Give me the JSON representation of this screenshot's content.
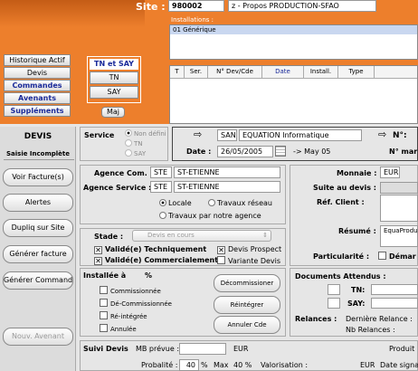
{
  "header": {
    "site_label": "Site :",
    "site_code": "980002",
    "site_name": "z - Propos PRODUCTION-SFAO",
    "installations_label": "Installations :",
    "installations": [
      "01 Générique"
    ],
    "left_links": [
      "Historique Actif",
      "Devis",
      "Commandes",
      "Avenants",
      "Suppléments"
    ],
    "tn_say_title": "TN et SAY",
    "tn_button": "TN",
    "say_button": "SAY",
    "maj_button": "Maj",
    "grid_columns": [
      "T",
      "Ser.",
      "N° Dev/Cde",
      "Date",
      "Install.",
      "Type"
    ]
  },
  "sidebar": {
    "title": "DEVIS",
    "status": "Saisie Incomplète",
    "buttons": [
      "Voir Facture(s)",
      "Alertes",
      "Dupliq sur Site",
      "Générer facture",
      "Générer Commande"
    ],
    "disabled_button": "Nouv. Avenant"
  },
  "service": {
    "label": "Service",
    "options": [
      "Non défini",
      "TN",
      "SAY"
    ]
  },
  "docinfo": {
    "code": "SAN",
    "company": "EQUATION Informatique",
    "date_label": "Date :",
    "date_value": "26/05/2005",
    "date_arrow_text": "-> May 05",
    "no_label": "N°:",
    "no_marche_label": "N° mar"
  },
  "agence": {
    "com_label": "Agence Com. :",
    "com_code": "STE",
    "com_name": "ST-ETIENNE",
    "service_label": "Agence Service :",
    "service_code": "STE",
    "service_name": "ST-ETIENNE",
    "radio_locale": "Locale",
    "radio_reseau": "Travaux réseau",
    "radio_notre": "Travaux par notre agence"
  },
  "right": {
    "monnaie_label": "Monnaie :",
    "monnaie_value": "EUR",
    "suite_label": "Suite au devis :",
    "ref_client_label": "Réf. Client :",
    "resume_label": "Résumé :",
    "resume_value": "EquaProduct",
    "particularite_label": "Particularité :",
    "particularite_option": "Démar"
  },
  "stade": {
    "label": "Stade :",
    "select_value": "Devis en cours",
    "checks": [
      {
        "label": "Validé(e) Techniquement",
        "checked": true
      },
      {
        "label": "Devis Prospect",
        "checked": true
      },
      {
        "label": "Validé(e) Commercialement",
        "checked": true
      },
      {
        "label": "Variante Devis",
        "checked": false
      }
    ]
  },
  "installe": {
    "label": "Installée à",
    "percent": "%",
    "checks": [
      "Commissionnée",
      "Dé-Commissionnée",
      "Ré-intégrée",
      "Annulée"
    ],
    "buttons": [
      "Décommissioner",
      "Réintégrer",
      "Annuler Cde"
    ]
  },
  "documents": {
    "label": "Documents Attendus :",
    "tn_label": "TN:",
    "say_label": "SAY:",
    "relances_label": "Relances :",
    "derniere_relance": "Dernière Relance :",
    "nb_relances": "Nb Relances :"
  },
  "suivi": {
    "label": "Suivi Devis",
    "mb_prevue_label": "MB prévue :",
    "currency": "EUR",
    "probabilite_label": "Probalité :",
    "probabilite_value": "40",
    "percent": "%",
    "max_label": "Max",
    "max_value": "40 %",
    "valorisation_label": "Valorisation :",
    "val_currency": "EUR",
    "date_signature": "Date signatu",
    "produit": "Produit"
  }
}
